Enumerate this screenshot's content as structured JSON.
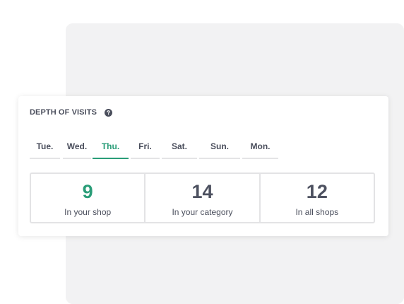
{
  "card": {
    "title": "DEPTH OF VISITS",
    "help_icon": "question-circle-icon"
  },
  "tabs": [
    {
      "label": "Tue.",
      "active": false
    },
    {
      "label": "Wed.",
      "active": false
    },
    {
      "label": "Thu.",
      "active": true
    },
    {
      "label": "Fri.",
      "active": false
    },
    {
      "label": "Sat.",
      "active": false
    },
    {
      "label": "Sun.",
      "active": false
    },
    {
      "label": "Mon.",
      "active": false
    }
  ],
  "stats": [
    {
      "value": "9",
      "label": "In your shop",
      "highlight": true
    },
    {
      "value": "14",
      "label": "In your category",
      "highlight": false
    },
    {
      "value": "12",
      "label": "In all shops",
      "highlight": false
    }
  ],
  "colors": {
    "accent": "#2a9d78",
    "text": "#4a4e5c",
    "border": "#e3e3e5",
    "background_panel": "#f2f2f3"
  }
}
